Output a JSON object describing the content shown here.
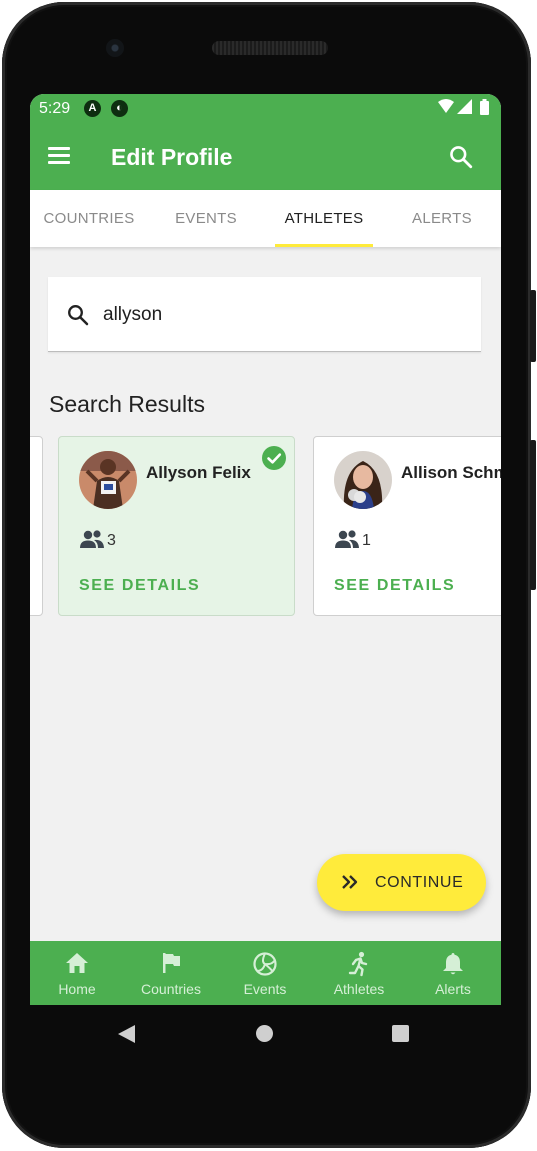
{
  "status_bar": {
    "time": "5:29"
  },
  "app_bar": {
    "title": "Edit Profile"
  },
  "tabs": [
    {
      "label": "COUNTRIES"
    },
    {
      "label": "EVENTS"
    },
    {
      "label": "ATHLETES",
      "active": true
    },
    {
      "label": "ALERTS"
    }
  ],
  "search": {
    "value": "allyson",
    "placeholder": ""
  },
  "section_title": "Search Results",
  "results": [
    {
      "name": "Allyson Felix",
      "count": "3",
      "details": "SEE DETAILS",
      "selected": true
    },
    {
      "name": "Allison Schm",
      "count": "1",
      "details": "SEE DETAILS",
      "selected": false
    }
  ],
  "fab": {
    "label": "CONTINUE",
    "icon": "double-chevron-right-icon"
  },
  "bottom_nav": [
    {
      "label": "Home",
      "icon": "home-icon"
    },
    {
      "label": "Countries",
      "icon": "flag-icon"
    },
    {
      "label": "Events",
      "icon": "volleyball-icon"
    },
    {
      "label": "Athletes",
      "icon": "runner-icon"
    },
    {
      "label": "Alerts",
      "icon": "bell-icon"
    }
  ],
  "colors": {
    "primary": "#4caf50",
    "accent": "#ffeb3b",
    "background": "#f1f1f1",
    "selected_card": "#e6f4e6"
  }
}
